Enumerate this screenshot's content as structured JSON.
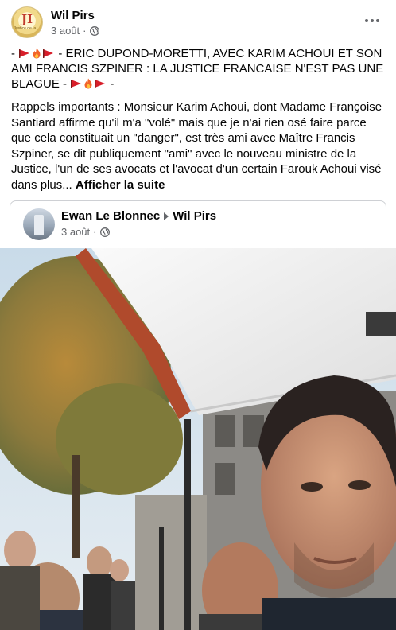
{
  "post": {
    "page_name": "Wil Pirs",
    "avatar_monogram": "JI",
    "avatar_subtext": "Justice de la ...",
    "date": "3 août",
    "separator": "·",
    "title_lead": "- ",
    "title_mid": " - ERIC DUPOND-MORETTI, AVEC KARIM ACHOUI ET SON AMI FRANCIS SZPINER : LA JUSTICE FRANCAISE N'EST PAS UNE BLAGUE - ",
    "title_tail": " -",
    "body": "Rappels importants : Monsieur Karim Achoui, dont Madame Françoise Santiard affirme qu'il m'a \"volé\" mais que je n'ai rien osé faire parce que cela constituait un \"danger\", est très ami avec Maître Francis Szpiner, se dit publiquement \"ami\" avec le nouveau ministre de la Justice, l'un de ses avocats et l'avocat d'un certain Farouk Achoui visé dans plus... ",
    "see_more": "Afficher la suite"
  },
  "shared": {
    "from_name": "Ewan Le Blonnec",
    "to_name": "Wil Pirs",
    "date": "3 août",
    "separator": "·"
  },
  "colors": {
    "secondary_text": "#65676b",
    "primary_text": "#050505",
    "border": "#ced0d4"
  },
  "icons": [
    "globe-icon",
    "more-options-icon",
    "triangular-flag-icon",
    "fire-icon",
    "arrow-right-icon"
  ]
}
